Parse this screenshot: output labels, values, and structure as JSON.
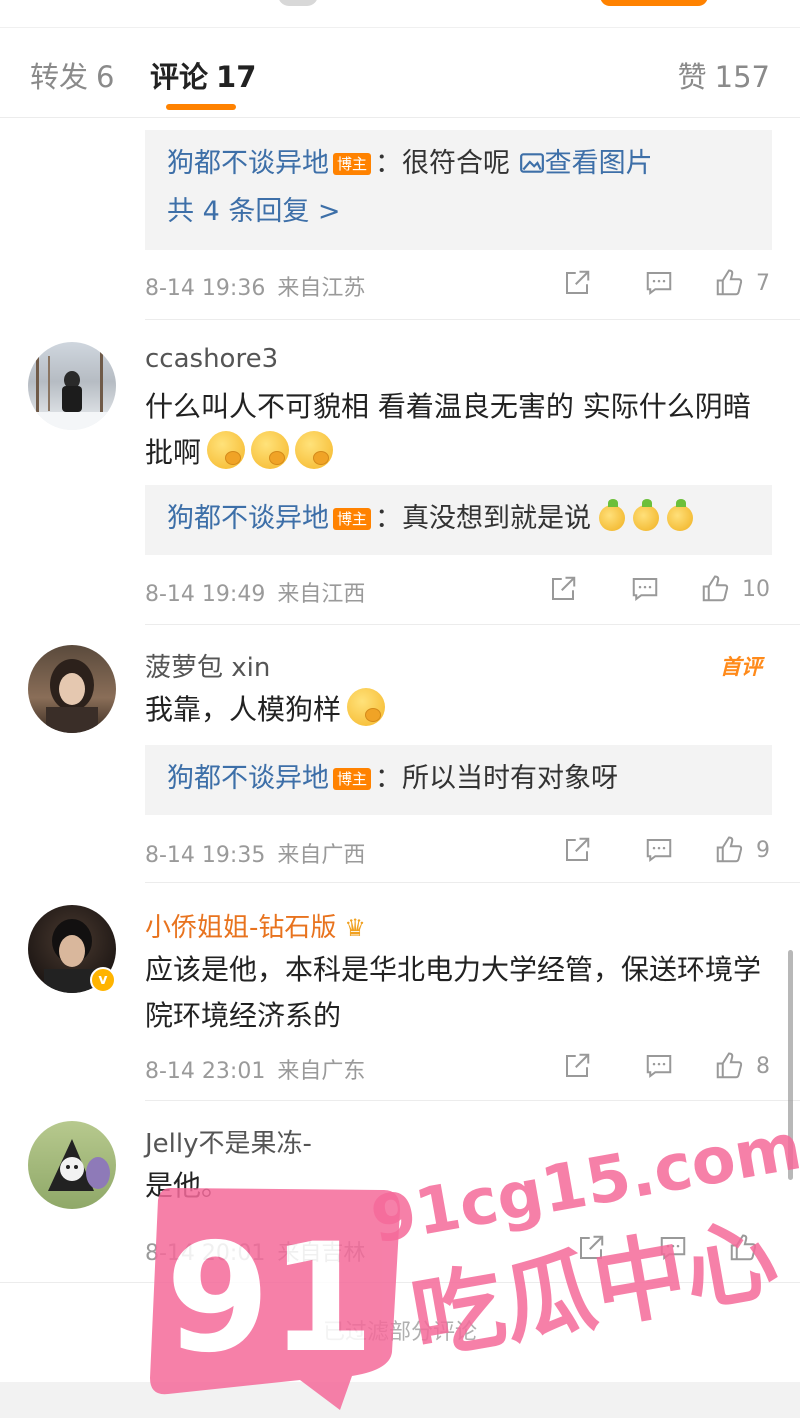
{
  "tabs": {
    "repost": {
      "label": "转发",
      "count": "6"
    },
    "comment": {
      "label": "评论",
      "count": "17"
    },
    "like": {
      "label": "赞",
      "count": "157"
    }
  },
  "comments": [
    {
      "user": "",
      "text": "",
      "reply": {
        "name": "狗都不谈异地",
        "badge": "博主",
        "text": "：很符合呢 ",
        "link": "查看图片",
        "more": "共 4 条回复 >"
      },
      "time": "8-14 19:36",
      "location": "来自江苏",
      "likes": "7"
    },
    {
      "user": "ccashore3",
      "text": "什么叫人不可貌相 看着温良无害的 实际什么阴暗批啊",
      "reply": {
        "name": "狗都不谈异地",
        "badge": "博主",
        "text": "：真没想到就是说"
      },
      "time": "8-14 19:49",
      "location": "来自江西",
      "likes": "10"
    },
    {
      "user": "菠萝包 xin",
      "first_tag": "首评",
      "text": "我靠，人模狗样",
      "reply": {
        "name": "狗都不谈异地",
        "badge": "博主",
        "text": "：所以当时有对象呀"
      },
      "time": "8-14 19:35",
      "location": "来自广西",
      "likes": "9"
    },
    {
      "user": "小侨姐姐-钻石版",
      "text": "应该是他，本科是华北电力大学经管，保送环境学院环境经济系的",
      "time": "8-14 23:01",
      "location": "来自广东",
      "likes": "8"
    },
    {
      "user": "Jelly不是果冻-",
      "text": "是他。",
      "time": "8-14 20:01",
      "location": "来自吉林",
      "likes": ""
    }
  ],
  "filtered_note": "已过滤部分评论",
  "watermark": {
    "big": "91",
    "domain": "91cg15.com",
    "slogan": "吃瓜中心",
    "color": "#f56a9a"
  }
}
